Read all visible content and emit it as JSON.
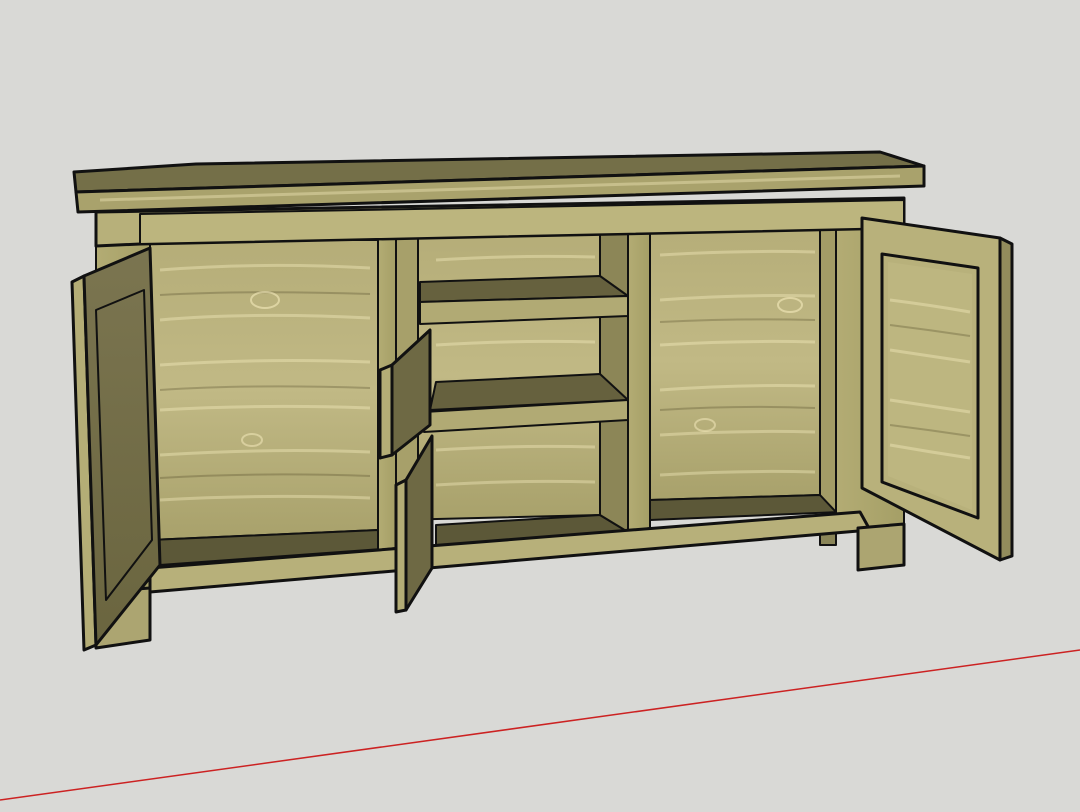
{
  "scene": {
    "subject": "sideboard-3d-model",
    "colors": {
      "background": "#d9d9d6",
      "wood_light": "#b9b27c",
      "wood_mid": "#9f9a62",
      "wood_dark": "#6b6641",
      "wood_top": "#746f48",
      "shadow": "#4f4b33",
      "edge": "#111111",
      "axis_red": "#cc2222"
    }
  }
}
